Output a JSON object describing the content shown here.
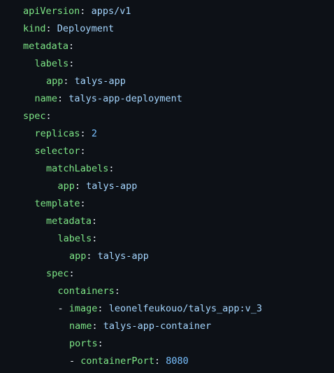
{
  "file": {
    "language": "yaml",
    "lines": [
      {
        "indent": 0,
        "key": "apiVersion",
        "value": "apps/v1",
        "value_type": "string"
      },
      {
        "indent": 0,
        "key": "kind",
        "value": "Deployment",
        "value_type": "string"
      },
      {
        "indent": 0,
        "key": "metadata",
        "value": "",
        "value_type": "none"
      },
      {
        "indent": 1,
        "key": "labels",
        "value": "",
        "value_type": "none"
      },
      {
        "indent": 2,
        "key": "app",
        "value": "talys-app",
        "value_type": "string"
      },
      {
        "indent": 1,
        "key": "name",
        "value": "talys-app-deployment",
        "value_type": "string"
      },
      {
        "indent": 0,
        "key": "spec",
        "value": "",
        "value_type": "none"
      },
      {
        "indent": 1,
        "key": "replicas",
        "value": "2",
        "value_type": "number"
      },
      {
        "indent": 1,
        "key": "selector",
        "value": "",
        "value_type": "none"
      },
      {
        "indent": 2,
        "key": "matchLabels",
        "value": "",
        "value_type": "none"
      },
      {
        "indent": 3,
        "key": "app",
        "value": "talys-app",
        "value_type": "string"
      },
      {
        "indent": 1,
        "key": "template",
        "value": "",
        "value_type": "none"
      },
      {
        "indent": 2,
        "key": "metadata",
        "value": "",
        "value_type": "none"
      },
      {
        "indent": 3,
        "key": "labels",
        "value": "",
        "value_type": "none"
      },
      {
        "indent": 4,
        "key": "app",
        "value": "talys-app",
        "value_type": "string"
      },
      {
        "indent": 2,
        "key": "spec",
        "value": "",
        "value_type": "none"
      },
      {
        "indent": 3,
        "key": "containers",
        "value": "",
        "value_type": "none"
      },
      {
        "indent": 3,
        "dash": "-",
        "key": "image",
        "value": "leonelfeukouo/talys_app:v_3",
        "value_type": "string"
      },
      {
        "indent": 4,
        "key": "name",
        "value": "talys-app-container",
        "value_type": "string"
      },
      {
        "indent": 4,
        "key": "ports",
        "value": "",
        "value_type": "none"
      },
      {
        "indent": 4,
        "dash": "-",
        "key": "containerPort",
        "value": "8080",
        "value_type": "number"
      }
    ]
  },
  "colors": {
    "background": "#0d1117",
    "key": "#7ee787",
    "string_value": "#a5d6ff",
    "number_value": "#79c0ff",
    "punctuation": "#e6edf3"
  }
}
